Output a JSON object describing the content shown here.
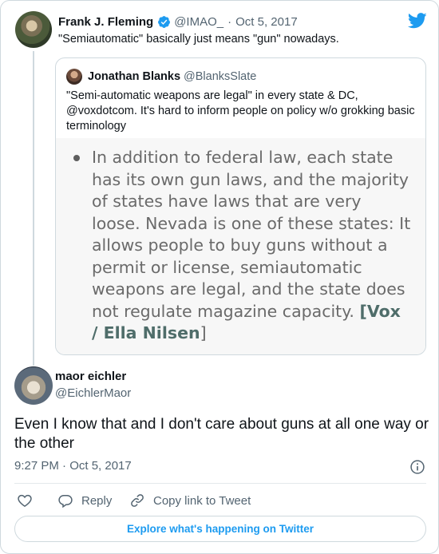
{
  "parent_tweet": {
    "name": "Frank J. Fleming",
    "handle": "@IMAO_",
    "separator": "·",
    "date": "Oct 5, 2017",
    "text": "\"Semiautomatic\" basically just means \"gun\" nowadays."
  },
  "quoted_tweet": {
    "name": "Jonathan Blanks",
    "handle": "@BlanksSlate",
    "text": "\"Semi-automatic weapons are legal\" in every state & DC, @voxdotcom. It's hard to inform people on policy w/o grokking basic terminology",
    "image_text_main": "In addition to federal law, each state has its own gun laws, and the majority of states have laws that are very loose. Nevada is one of these states: It allows people to buy guns without a permit or license, semiautomatic weapons are legal, and the state does not regulate magazine capacity. ",
    "image_text_source_open": "[",
    "image_text_source": "Vox / Ella Nilsen",
    "image_text_source_close": "]"
  },
  "reply_tweet": {
    "name": "maor eichler",
    "handle": "@EichlerMaor",
    "text": "Even I know that and I don't care about guns at all one way or the other",
    "timestamp": "9:27 PM · Oct 5, 2017"
  },
  "actions": {
    "reply_label": "Reply",
    "copy_link_label": "Copy link to Tweet"
  },
  "explore_label": "Explore what's happening on Twitter",
  "colors": {
    "accent": "#1d9bf0",
    "secondary_text": "#536471",
    "border": "#cfd9de"
  },
  "icons": [
    "verified-badge-icon",
    "twitter-bird-icon",
    "info-icon",
    "like-heart-icon",
    "reply-bubble-icon",
    "copy-link-icon"
  ]
}
